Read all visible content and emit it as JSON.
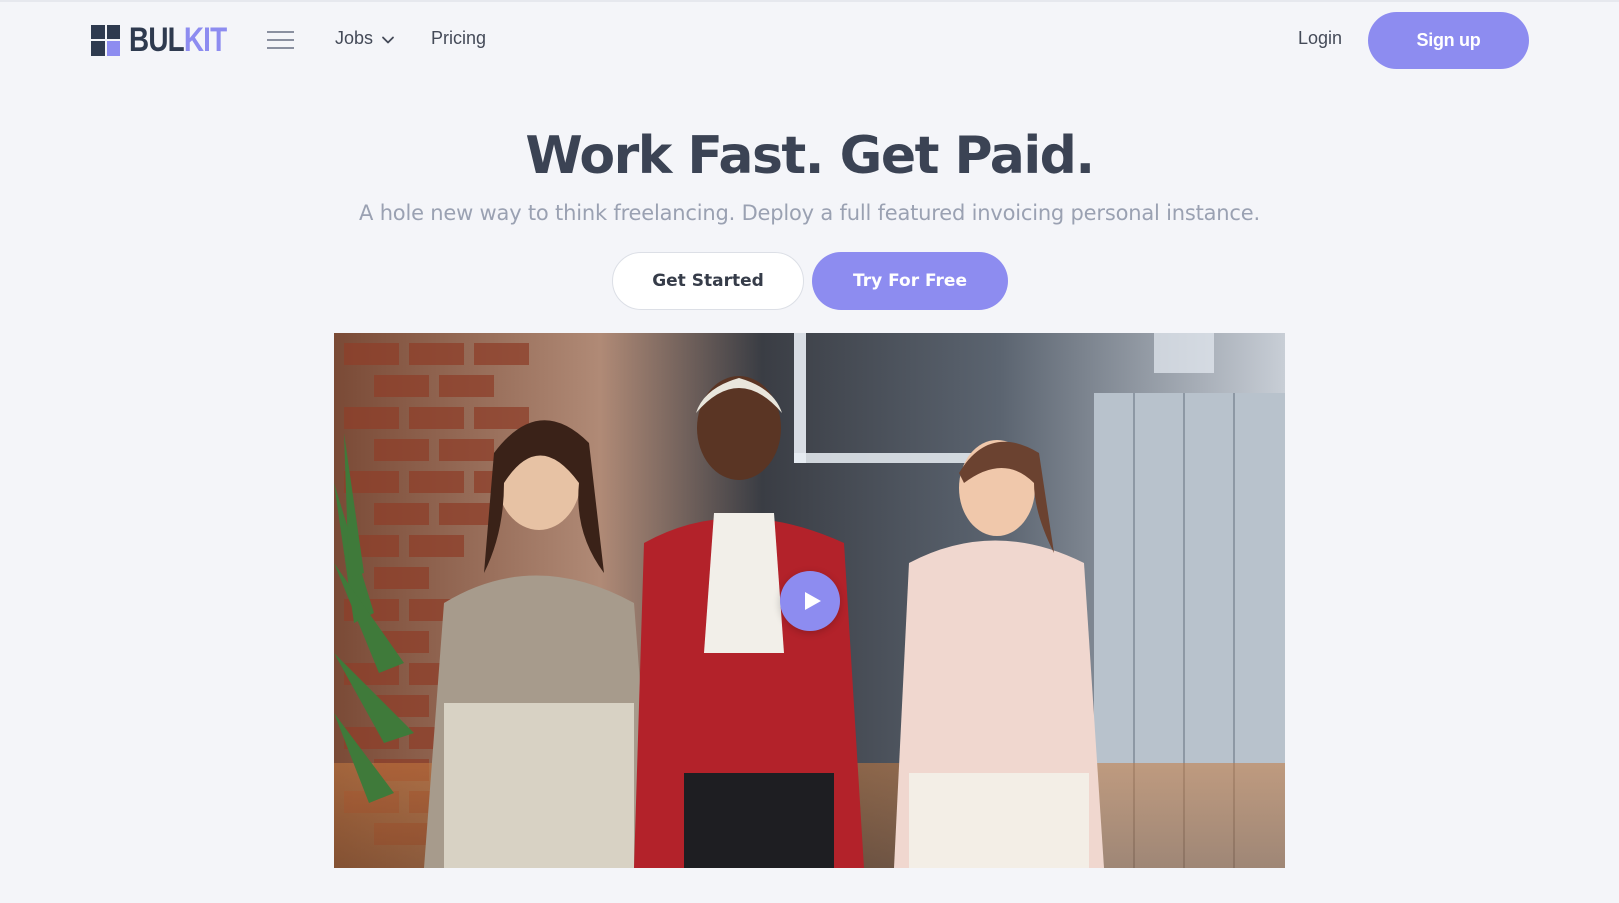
{
  "brand": {
    "logo_text_main": "BUL",
    "logo_text_accent": "KIT"
  },
  "nav": {
    "jobs_label": "Jobs",
    "pricing_label": "Pricing",
    "login_label": "Login",
    "signup_label": "Sign up"
  },
  "hero": {
    "title": "Work Fast. Get Paid.",
    "subtitle": "A hole new way to think freelancing. Deploy a full featured invoicing personal instance.",
    "primary_cta": "Get Started",
    "secondary_cta": "Try For Free"
  },
  "video": {
    "play_icon": "play-icon"
  },
  "colors": {
    "accent": "#8d8cf0",
    "dark": "#2e3a4f",
    "background": "#f4f5f9",
    "muted_text": "#9aa1b2"
  }
}
